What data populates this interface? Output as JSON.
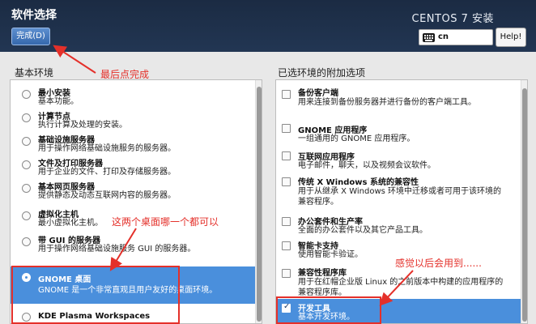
{
  "header": {
    "title": "软件选择",
    "done_label": "完成(D)",
    "product": "CENTOS 7 安装",
    "keyboard_layout": "cn",
    "help_label": "Help!"
  },
  "left": {
    "title": "基本环境",
    "items": [
      {
        "name": "最小安装",
        "desc": [
          "基本功能。"
        ],
        "selected": false
      },
      {
        "name": "计算节点",
        "desc": [
          "执行计算及处理的安装。"
        ],
        "selected": false
      },
      {
        "name": "基础设施服务器",
        "desc": [
          "用于操作网络基础设施服务的服务器。"
        ],
        "selected": false
      },
      {
        "name": "文件及打印服务器",
        "desc": [
          "用于企业的文件、打印及存储服务器。"
        ],
        "selected": false
      },
      {
        "name": "基本网页服务器",
        "desc": [
          "提供静态及动态互联网内容的服务器。"
        ],
        "selected": false
      },
      {
        "name": "虚拟化主机",
        "desc": [
          "最小虚拟化主机。"
        ],
        "selected": false
      },
      {
        "name": "带 GUI 的服务器",
        "desc": [
          "用于操作网络基础设施服务 GUI 的服务器。"
        ],
        "selected": false
      },
      {
        "name": "GNOME 桌面",
        "desc": [
          "GNOME 是一个非常直观且用户友好的桌面环境。"
        ],
        "selected": true
      },
      {
        "name": "KDE Plasma Workspaces",
        "desc": [],
        "selected": false
      }
    ]
  },
  "right": {
    "title": "已选环境的附加选项",
    "items": [
      {
        "name": "备份客户端",
        "desc": [
          "用来连接到备份服务器并进行备份的客户端工具。"
        ],
        "selected": false
      },
      {
        "name": "GNOME 应用程序",
        "desc": [
          "一组通用的 GNOME 应用程序。"
        ],
        "selected": false
      },
      {
        "name": "互联网应用程序",
        "desc": [
          "电子邮件，聊天，以及视频会议软件。"
        ],
        "selected": false
      },
      {
        "name": "传统 X Windows 系统的兼容性",
        "desc": [
          "用于从继承 X Windows 环境中迁移或者可用于该环境的",
          "兼容程序。"
        ],
        "selected": false
      },
      {
        "name": "办公套件和生产率",
        "desc": [
          "全面的办公套件以及其它产品工具。"
        ],
        "selected": false
      },
      {
        "name": "智能卡支持",
        "desc": [
          "使用智能卡验证。"
        ],
        "selected": false
      },
      {
        "name": "兼容性程序库",
        "desc": [
          "用于在红帽企业版 Linux 的之前版本中构建的应用程序的",
          "兼容程序库。"
        ],
        "selected": false
      },
      {
        "name": "开发工具",
        "desc": [
          "基本开发环境。"
        ],
        "selected": true
      }
    ]
  },
  "annotations": {
    "note_done": "最后点完成",
    "note_desktop": "这两个桌面哪一个都可以",
    "note_devtools": "感觉以后会用到......",
    "color": "#e4302a"
  }
}
